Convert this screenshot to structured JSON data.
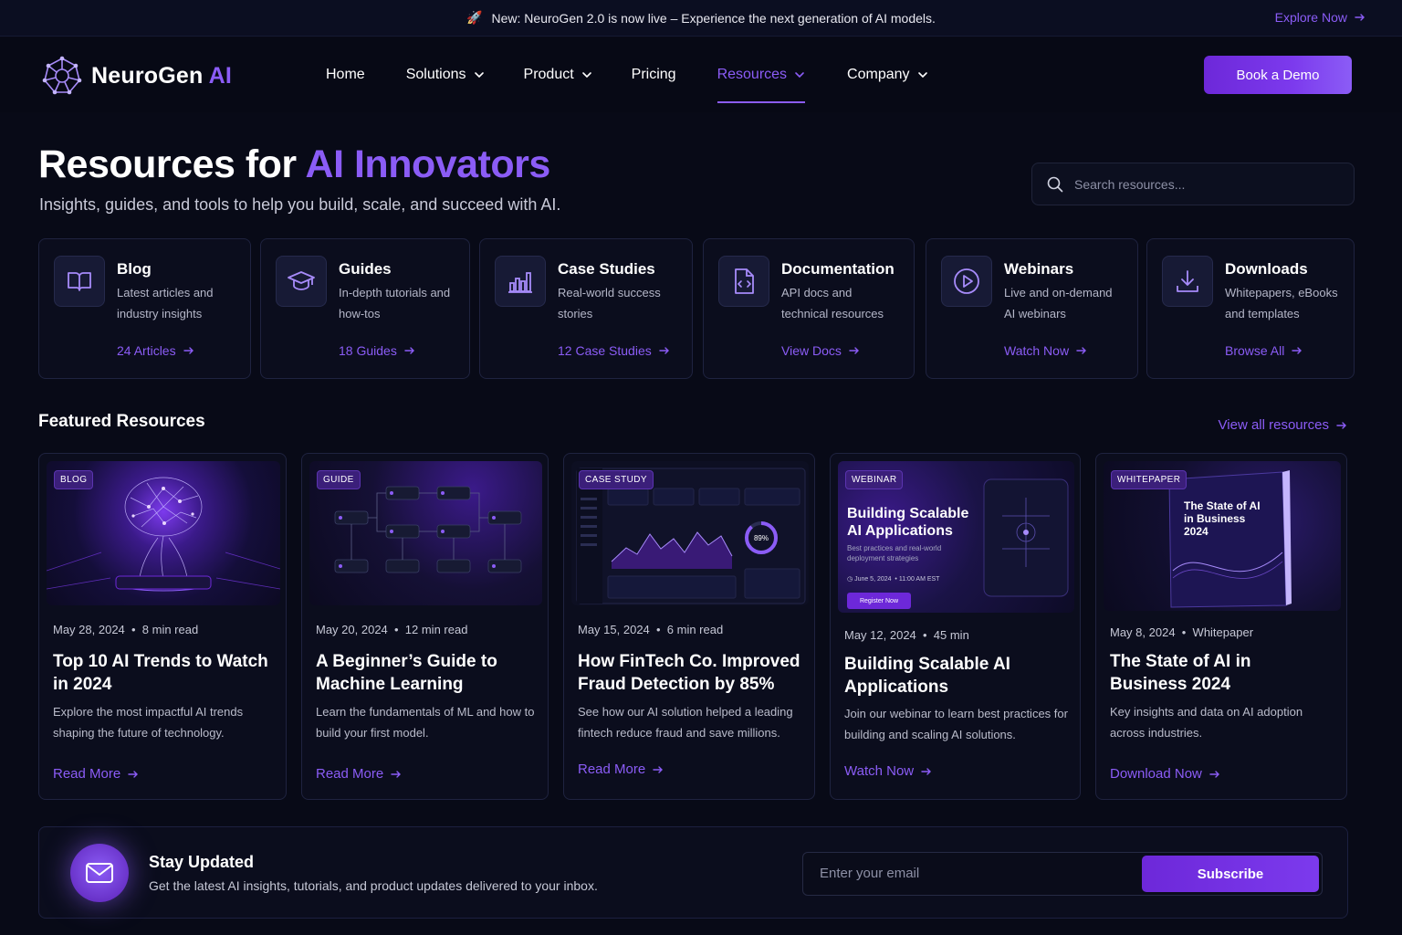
{
  "announcement": {
    "emoji": "🚀",
    "text": "New: NeuroGen 2.0 is now live – Experience the next generation of AI models.",
    "link": "Explore Now"
  },
  "brand": {
    "name": "NeuroGen",
    "suffix": "AI"
  },
  "nav": {
    "items": [
      {
        "label": "Home"
      },
      {
        "label": "Solutions"
      },
      {
        "label": "Product"
      },
      {
        "label": "Pricing"
      },
      {
        "label": "Resources"
      },
      {
        "label": "Company"
      }
    ],
    "active": "Resources",
    "cta": "Book a Demo"
  },
  "hero": {
    "title_prefix": "Resources for",
    "title_highlight": "AI Innovators",
    "subtitle": "Insights, guides, and tools to help you build, scale, and succeed with AI."
  },
  "search": {
    "placeholder": "Search resources..."
  },
  "categories": [
    {
      "title": "Blog",
      "desc": "Latest articles and industry insights",
      "link": "24 Articles",
      "icon": "book-icon"
    },
    {
      "title": "Guides",
      "desc": "In-depth tutorials and how-tos",
      "link": "18 Guides",
      "icon": "graduation-cap-icon"
    },
    {
      "title": "Case Studies",
      "desc": "Real-world success stories",
      "link": "12 Case Studies",
      "icon": "bar-chart-icon"
    },
    {
      "title": "Documentation",
      "desc": "API docs and technical resources",
      "link": "View Docs",
      "icon": "code-file-icon"
    },
    {
      "title": "Webinars",
      "desc": "Live and on-demand AI webinars",
      "link": "Watch Now",
      "icon": "play-circle-icon"
    },
    {
      "title": "Downloads",
      "desc": "Whitepapers, eBooks and templates",
      "link": "Browse All",
      "icon": "download-icon"
    }
  ],
  "featured": {
    "title": "Featured Resources",
    "view_all": "View all resources",
    "cards": [
      {
        "tag": "BLOG",
        "date": "May 28, 2024",
        "extra": "8 min read",
        "title": "Top 10 AI Trends to Watch in 2024",
        "desc": "Explore the most impactful AI trends shaping the future of technology.",
        "link": "Read More"
      },
      {
        "tag": "GUIDE",
        "date": "May 20, 2024",
        "extra": "12 min read",
        "title": "A Beginner’s Guide to Machine Learning",
        "desc": "Learn the fundamentals of ML and how to build your first model.",
        "link": "Read More"
      },
      {
        "tag": "CASE STUDY",
        "date": "May 15, 2024",
        "extra": "6 min read",
        "title": "How FinTech Co. Improved Fraud Detection by 85%",
        "desc": "See how our AI solution helped a leading fintech reduce fraud and save millions.",
        "link": "Read More",
        "gauge": "89%"
      },
      {
        "tag": "WEBINAR",
        "date": "May 12, 2024",
        "extra": "45 min",
        "title": "Building Scalable AI Applications",
        "desc": "Join our webinar to learn best practices for building and scaling AI solutions.",
        "link": "Watch Now",
        "img_title": "Building Scalable AI Applications",
        "img_sub": "Best practices and real-world deployment strategies",
        "img_date": "June 5, 2024",
        "img_time": "11:00 AM EST",
        "img_btn": "Register Now"
      },
      {
        "tag": "WHITEPAPER",
        "date": "May 8, 2024",
        "extra": "Whitepaper",
        "title": "The State of AI in Business 2024",
        "desc": "Key insights and data on AI adoption across industries.",
        "link": "Download Now",
        "book_title": "The State of AI in Business 2024"
      }
    ]
  },
  "newsletter": {
    "title": "Stay Updated",
    "desc": "Get the latest AI insights, tutorials, and product updates delivered to your inbox.",
    "placeholder": "Enter your email",
    "button": "Subscribe"
  },
  "colors": {
    "accent": "#8b5cf6",
    "background": "#080a17",
    "card": "#0b0d1d",
    "border": "#1f2340"
  }
}
